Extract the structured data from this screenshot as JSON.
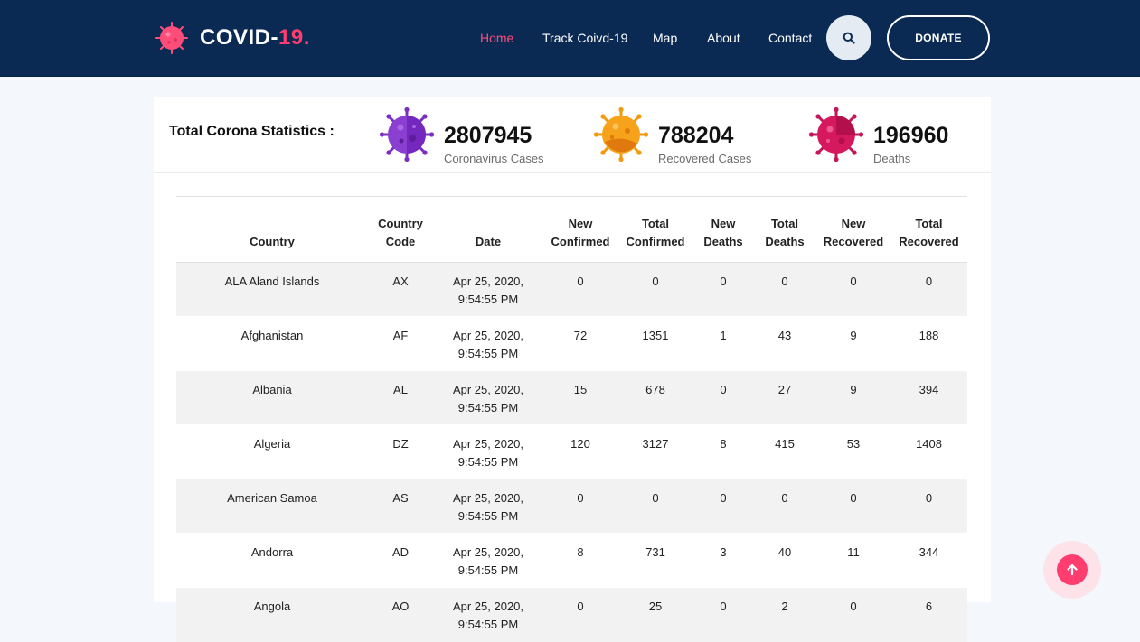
{
  "brand": {
    "name": "COVID-",
    "accent": "19.",
    "accent_color": "#ff3d6e"
  },
  "nav": {
    "home": "Home",
    "track": "Track Coivd-19",
    "map": "Map",
    "about": "About",
    "contact": "Contact",
    "search_icon": "search-icon",
    "donate": "DONATE"
  },
  "stats": {
    "title": "Total Corona Statistics :",
    "cases": {
      "value": "2807945",
      "label": "Coronavirus Cases",
      "icon": "virus-purple-icon",
      "color": "#8a3fd1"
    },
    "recovered": {
      "value": "788204",
      "label": "Recovered Cases",
      "icon": "virus-orange-icon",
      "color": "#f7a21b"
    },
    "deaths": {
      "value": "196960",
      "label": "Deaths",
      "icon": "virus-red-icon",
      "color": "#d6195f"
    }
  },
  "table": {
    "headers": {
      "country": "Country",
      "code_1": "Country",
      "code_2": "Code",
      "date": "Date",
      "new_confirmed_1": "New",
      "new_confirmed_2": "Confirmed",
      "total_confirmed_1": "Total",
      "total_confirmed_2": "Confirmed",
      "new_deaths_1": "New",
      "new_deaths_2": "Deaths",
      "total_deaths_1": "Total",
      "total_deaths_2": "Deaths",
      "new_recovered_1": "New",
      "new_recovered_2": "Recovered",
      "total_recovered_1": "Total",
      "total_recovered_2": "Recovered"
    },
    "rows": [
      {
        "country": "ALA Aland Islands",
        "code": "AX",
        "date_1": "Apr 25, 2020,",
        "date_2": "9:54:55 PM",
        "new_confirmed": "0",
        "total_confirmed": "0",
        "new_deaths": "0",
        "total_deaths": "0",
        "new_recovered": "0",
        "total_recovered": "0"
      },
      {
        "country": "Afghanistan",
        "code": "AF",
        "date_1": "Apr 25, 2020,",
        "date_2": "9:54:55 PM",
        "new_confirmed": "72",
        "total_confirmed": "1351",
        "new_deaths": "1",
        "total_deaths": "43",
        "new_recovered": "9",
        "total_recovered": "188"
      },
      {
        "country": "Albania",
        "code": "AL",
        "date_1": "Apr 25, 2020,",
        "date_2": "9:54:55 PM",
        "new_confirmed": "15",
        "total_confirmed": "678",
        "new_deaths": "0",
        "total_deaths": "27",
        "new_recovered": "9",
        "total_recovered": "394"
      },
      {
        "country": "Algeria",
        "code": "DZ",
        "date_1": "Apr 25, 2020,",
        "date_2": "9:54:55 PM",
        "new_confirmed": "120",
        "total_confirmed": "3127",
        "new_deaths": "8",
        "total_deaths": "415",
        "new_recovered": "53",
        "total_recovered": "1408"
      },
      {
        "country": "American Samoa",
        "code": "AS",
        "date_1": "Apr 25, 2020,",
        "date_2": "9:54:55 PM",
        "new_confirmed": "0",
        "total_confirmed": "0",
        "new_deaths": "0",
        "total_deaths": "0",
        "new_recovered": "0",
        "total_recovered": "0"
      },
      {
        "country": "Andorra",
        "code": "AD",
        "date_1": "Apr 25, 2020,",
        "date_2": "9:54:55 PM",
        "new_confirmed": "8",
        "total_confirmed": "731",
        "new_deaths": "3",
        "total_deaths": "40",
        "new_recovered": "11",
        "total_recovered": "344"
      },
      {
        "country": "Angola",
        "code": "AO",
        "date_1": "Apr 25, 2020,",
        "date_2": "9:54:55 PM",
        "new_confirmed": "0",
        "total_confirmed": "25",
        "new_deaths": "0",
        "total_deaths": "2",
        "new_recovered": "0",
        "total_recovered": "6"
      }
    ]
  },
  "back_to_top_icon": "arrow-up-icon"
}
